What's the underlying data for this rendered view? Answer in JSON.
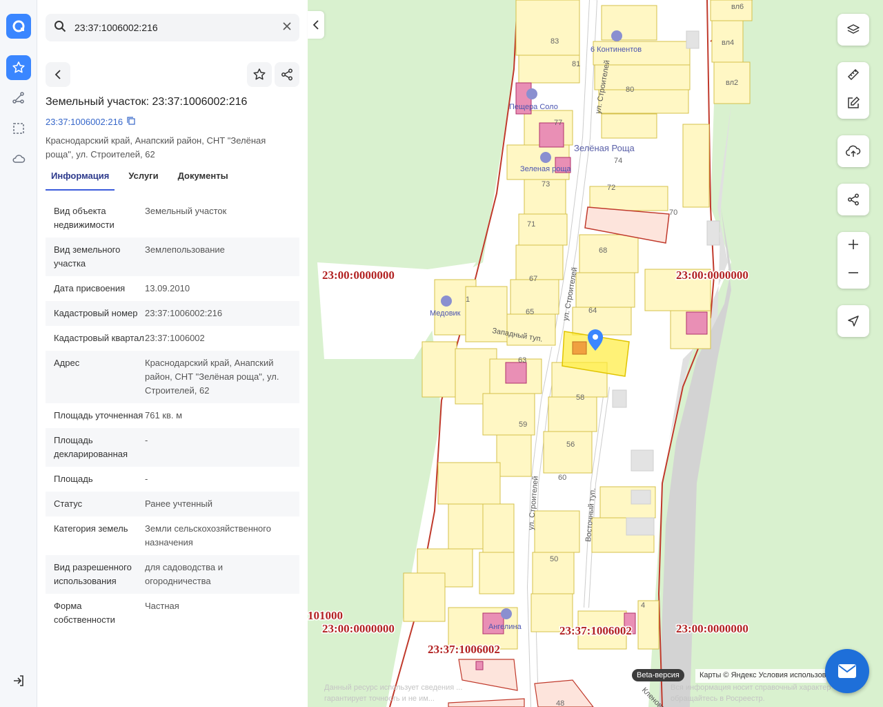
{
  "rail": {
    "logo": "logo-icon",
    "items": [
      "favorites-icon",
      "route-icon",
      "selection-icon",
      "cloud-icon"
    ],
    "logout": "logout-icon"
  },
  "search": {
    "value": "23:37:1006002:216"
  },
  "card": {
    "title": "Земельный участок: 23:37:1006002:216",
    "cad_link": "23:37:1006002:216",
    "address": "Краснодарский край, Анапский район, СНТ \"Зелёная роща\", ул. Строителей, 62",
    "tabs": [
      "Информация",
      "Услуги",
      "Документы"
    ]
  },
  "info": [
    {
      "k": "Вид объекта недвижимости",
      "v": "Земельный участок"
    },
    {
      "k": "Вид земельного участка",
      "v": "Землепользование"
    },
    {
      "k": "Дата присвоения",
      "v": "13.09.2010"
    },
    {
      "k": "Кадастровый номер",
      "v": "23:37:1006002:216"
    },
    {
      "k": "Кадастровый квартал",
      "v": "23:37:1006002"
    },
    {
      "k": "Адрес",
      "v": "Краснодарский край, Анапский район, СНТ \"Зелёная роща\", ул. Строителей, 62"
    },
    {
      "k": "Площадь уточненная",
      "v": "761 кв. м"
    },
    {
      "k": "Площадь декларированная",
      "v": "-"
    },
    {
      "k": "Площадь",
      "v": "-"
    },
    {
      "k": "Статус",
      "v": "Ранее учтенный"
    },
    {
      "k": "Категория земель",
      "v": "Земли сельскохозяйственного назначения"
    },
    {
      "k": "Вид разрешенного использования",
      "v": "для садоводства и огородничества"
    },
    {
      "k": "Форма собственности",
      "v": "Частная"
    }
  ],
  "map": {
    "zones": [
      "23:00:0000000",
      "23:00:0000000",
      "23:00:0000000",
      "23:00:0000000",
      "101000",
      "23:37:1006002",
      "23:37:1006002"
    ],
    "places": [
      "6 Континентов",
      "Пещера Соло",
      "Зелёная Роща",
      "Зеленая роща",
      "Медовик",
      "Ангелина"
    ],
    "streets": [
      "ул. Строителей",
      "ул. Строителей",
      "Западный туп.",
      "Восточный туп.",
      "ул. Строителей",
      "Кленовая"
    ],
    "lots": [
      "вл6",
      "вл4",
      "вл2",
      "83",
      "81",
      "80",
      "77",
      "74",
      "73",
      "72",
      "71",
      "70",
      "68",
      "67",
      "65",
      "64",
      "63",
      "59",
      "58",
      "56",
      "60",
      "50",
      "48",
      "4",
      "1"
    ],
    "beta": "Beta-версия",
    "attribution": "Карты © Яндекс   Условия использования",
    "disclaimer1": "Данный ресурс использует сведения ...",
    "disclaimer2": "Вся информация носит справочный характер",
    "disclaimer3": "гарантирует точность и не им...",
    "disclaimer4": "обращайтесь в Росреестр."
  }
}
